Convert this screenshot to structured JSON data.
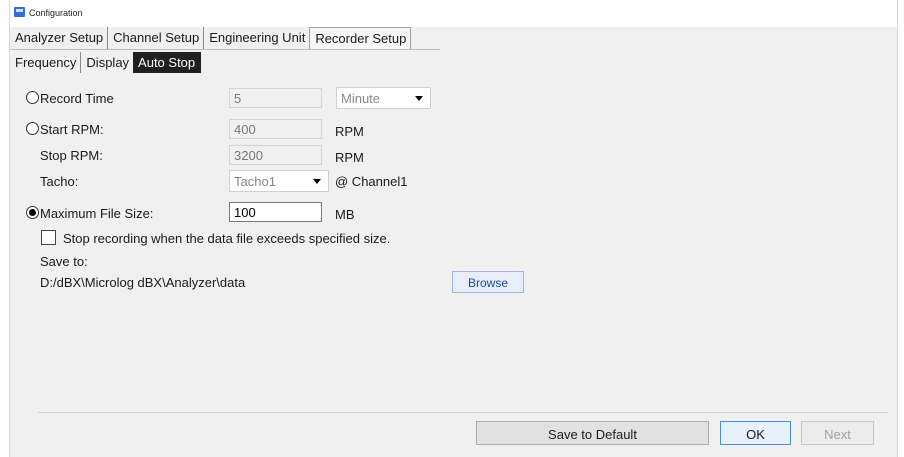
{
  "window": {
    "title": "Configuration"
  },
  "main_tabs": [
    {
      "label": "Analyzer Setup"
    },
    {
      "label": "Channel Setup"
    },
    {
      "label": "Engineering Unit"
    },
    {
      "label": "Recorder Setup"
    }
  ],
  "sub_tabs": [
    {
      "label": "Frequency"
    },
    {
      "label": "Display"
    },
    {
      "label": "Auto Stop"
    }
  ],
  "record_time": {
    "label": "Record Time",
    "value": "5",
    "unit_selected": "Minute",
    "selected": false
  },
  "start_rpm": {
    "label": "Start RPM:",
    "value": "400",
    "unit": "RPM",
    "selected": false
  },
  "stop_rpm": {
    "label": "Stop RPM:",
    "value": "3200",
    "unit": "RPM"
  },
  "tacho": {
    "label": "Tacho:",
    "selected": "Tacho1",
    "channel": "@ Channel1"
  },
  "max_file_size": {
    "label": "Maximum File Size:",
    "value": "100",
    "unit": "MB",
    "selected": true
  },
  "stop_recording": {
    "label": "Stop recording when the data file  exceeds specified size.",
    "checked": false
  },
  "save_to": {
    "label": "Save to:",
    "path": "D:/dBX\\Microlog dBX\\Analyzer\\data",
    "browse_label": "Browse"
  },
  "footer": {
    "save_default_label": "Save to Default",
    "ok_label": "OK",
    "next_label": "Next"
  }
}
